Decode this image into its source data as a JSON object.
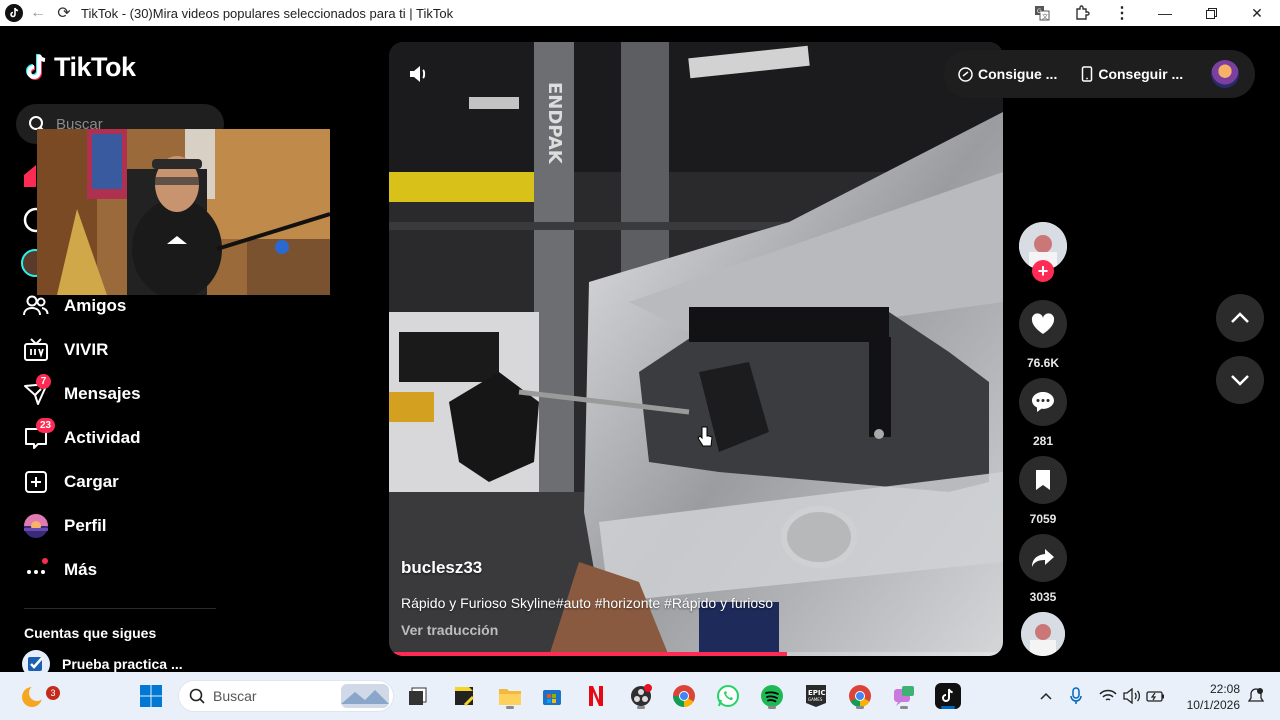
{
  "window": {
    "title": "TikTok - (30)Mira videos populares seleccionados para ti | TikTok"
  },
  "sidebar": {
    "logo_text": "TikTok",
    "search_placeholder": "Buscar",
    "items": [
      {
        "label": "Amigos",
        "icon": "friends-icon"
      },
      {
        "label": "VIVIR",
        "icon": "live-icon"
      },
      {
        "label": "Mensajes",
        "icon": "messages-icon",
        "badge": "7"
      },
      {
        "label": "Actividad",
        "icon": "activity-icon",
        "badge": "23"
      },
      {
        "label": "Cargar",
        "icon": "upload-icon"
      },
      {
        "label": "Perfil",
        "icon": "profile-avatar"
      },
      {
        "label": "Más",
        "icon": "more-icon"
      }
    ],
    "following_heading": "Cuentas que sigues",
    "following_accounts": [
      {
        "name": "Prueba practica ..."
      }
    ]
  },
  "topbar": {
    "coins_label": "Consigue ...",
    "app_label": "Conseguir ..."
  },
  "video": {
    "author": "buclesz33",
    "caption": "Rápido y Furioso Skyline#auto #horizonte #Rápido y furioso",
    "translate_label": "Ver traducción",
    "progress": 0.648
  },
  "actions": {
    "likes": "76.6K",
    "comments": "281",
    "saves": "7059",
    "shares": "3035"
  },
  "taskbar": {
    "search_placeholder": "Buscar",
    "weather_badge": "3",
    "time": "22:08",
    "date": "10/1/2026"
  },
  "colors": {
    "accent": "#fe2c55",
    "background": "#000000",
    "taskbar": "#e9f0fa"
  }
}
